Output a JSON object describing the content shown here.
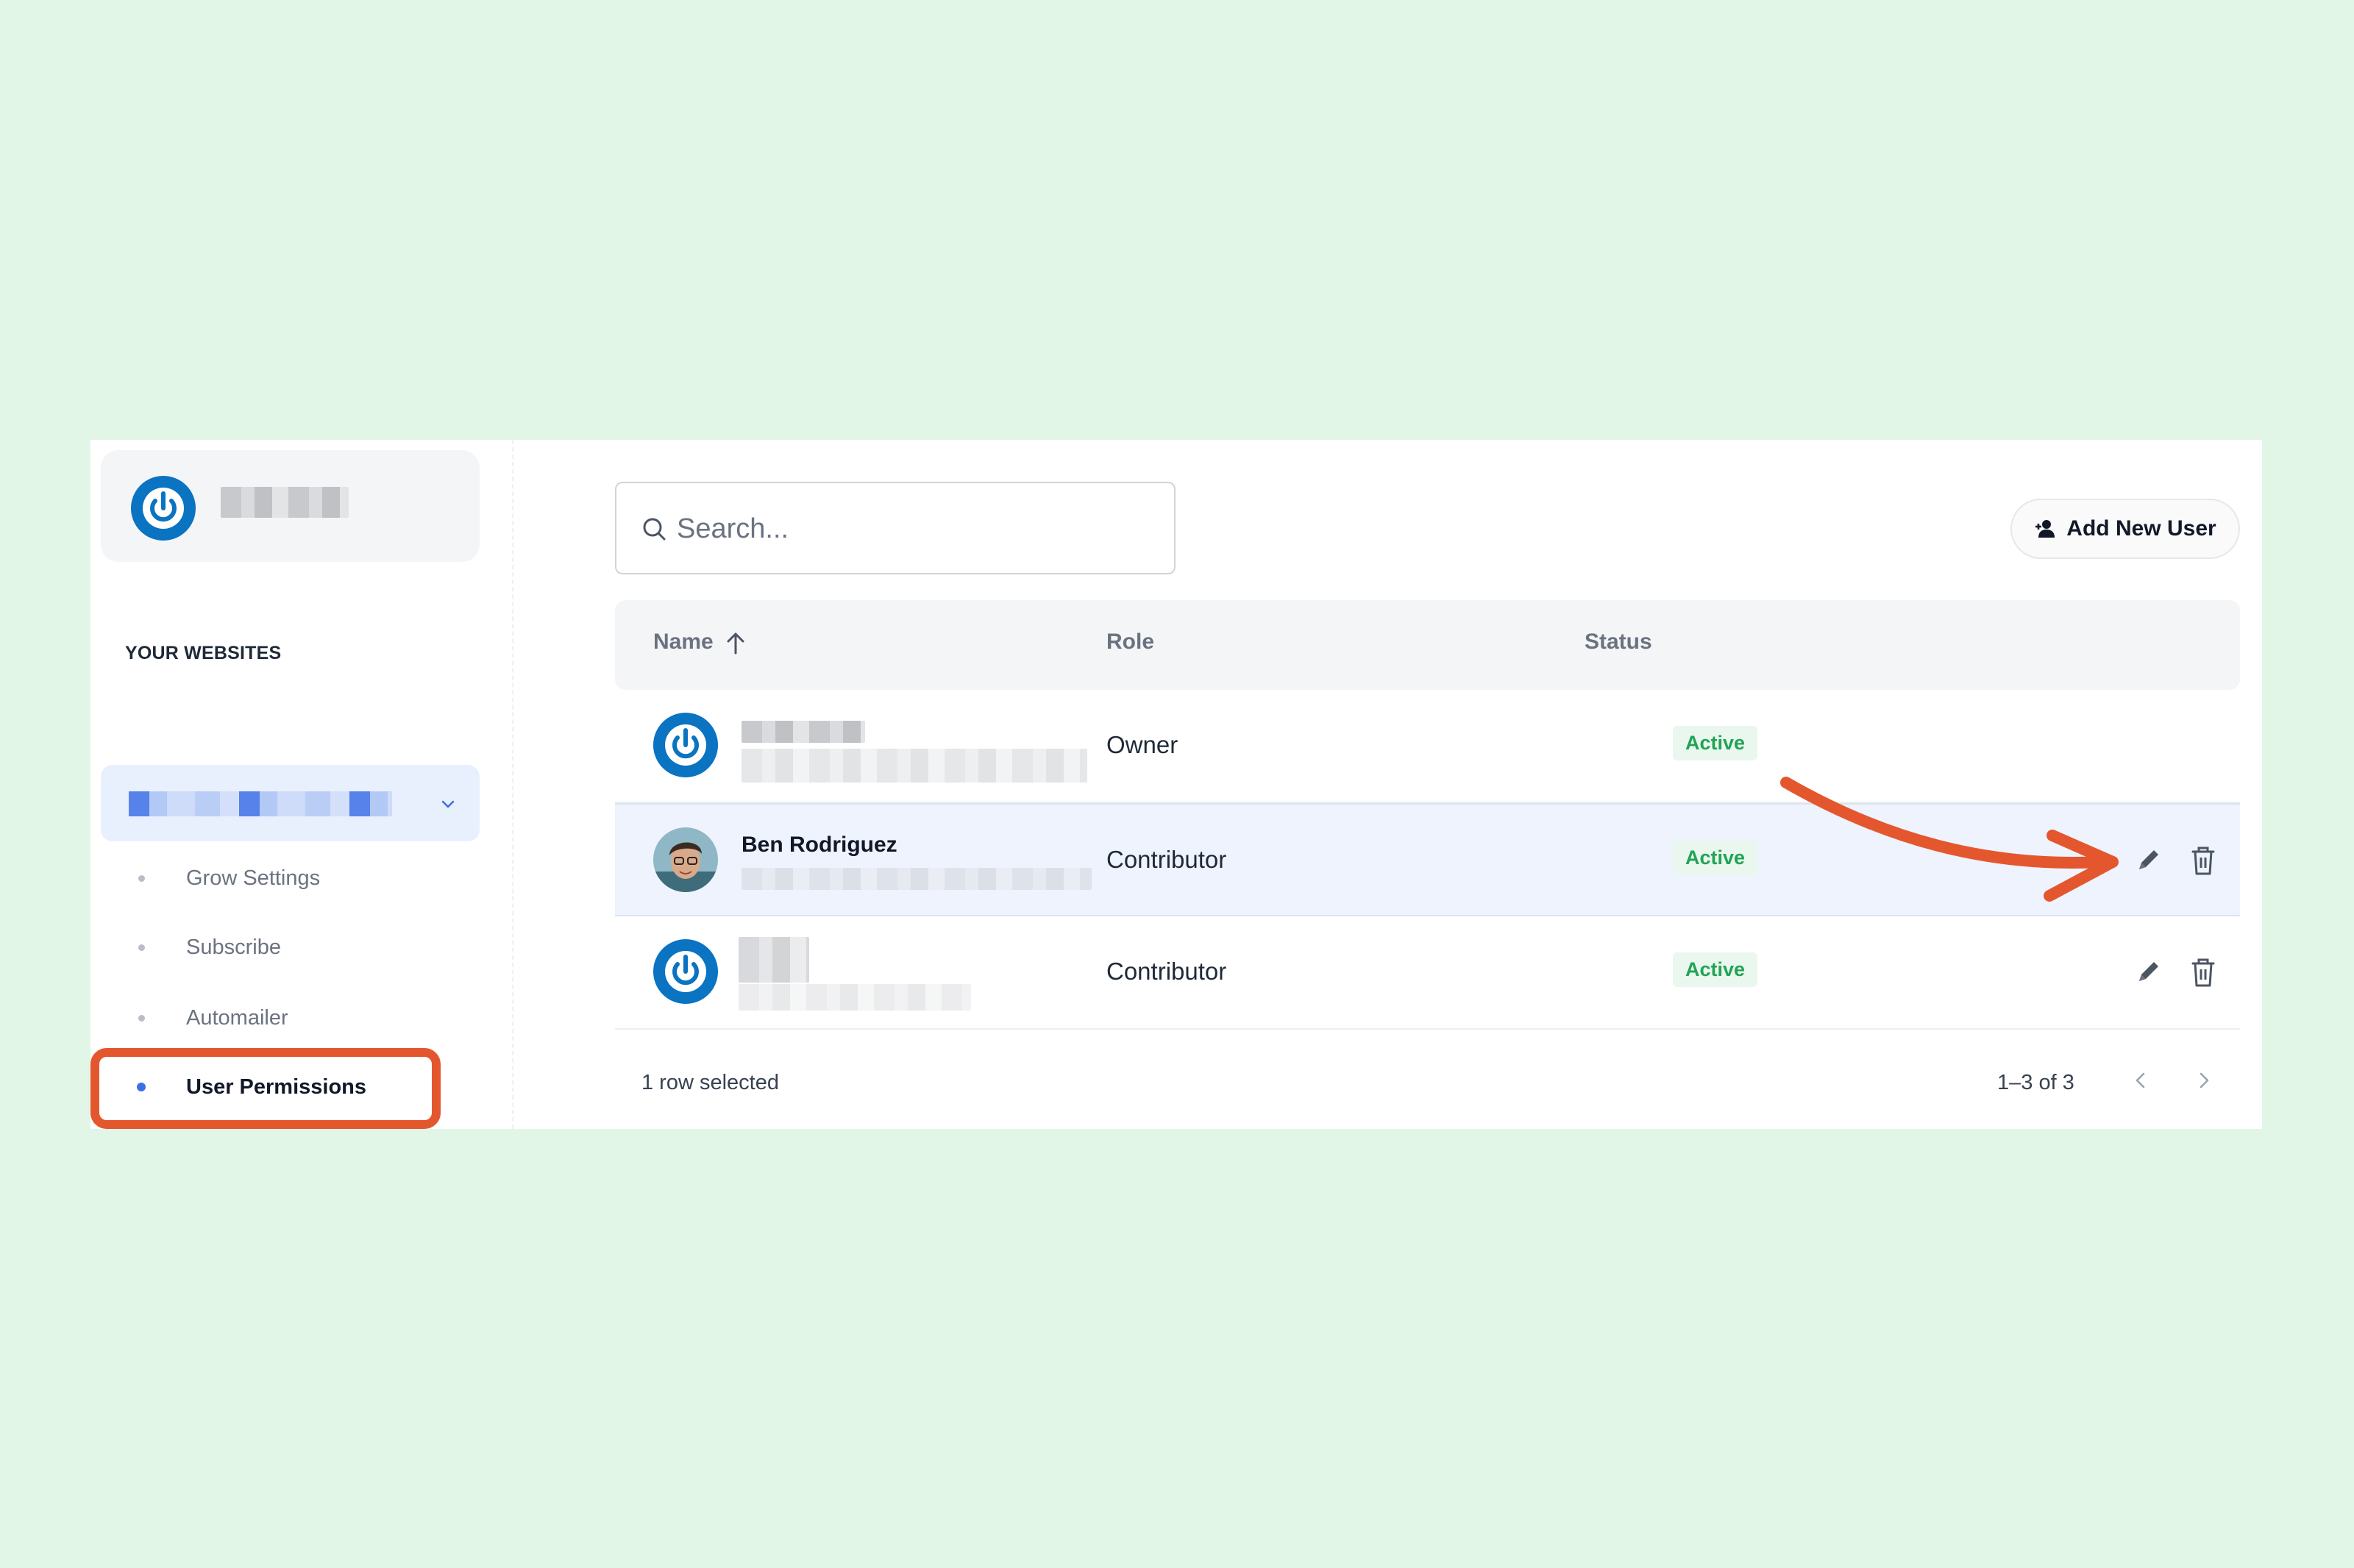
{
  "sidebar": {
    "section_heading": "YOUR WEBSITES",
    "nav_items": [
      {
        "label": "Grow Settings",
        "active": false
      },
      {
        "label": "Subscribe",
        "active": false
      },
      {
        "label": "Automailer",
        "active": false
      },
      {
        "label": "User Permissions",
        "active": true
      }
    ]
  },
  "toolbar": {
    "search_placeholder": "Search...",
    "add_user_label": "Add New User"
  },
  "table": {
    "columns": [
      {
        "label": "Name",
        "sorted": "ascending"
      },
      {
        "label": "Role"
      },
      {
        "label": "Status"
      }
    ],
    "rows": [
      {
        "name": "",
        "role": "Owner",
        "status": "Active",
        "selected": false,
        "avatar": "power-logo"
      },
      {
        "name": "Ben Rodriguez",
        "role": "Contributor",
        "status": "Active",
        "selected": true,
        "avatar": "photo"
      },
      {
        "name": "",
        "role": "Contributor",
        "status": "Active",
        "selected": false,
        "avatar": "power-logo"
      }
    ]
  },
  "footer": {
    "selection_text": "1 row selected",
    "pagination_text": "1–3 of 3"
  },
  "colors": {
    "accent_blue": "#0a73c2",
    "status_green": "#22a356",
    "highlight_orange": "#e4572e",
    "background": "#e1f6e6"
  },
  "icons": [
    "power-icon",
    "chevron-down-icon",
    "search-icon",
    "add-user-icon",
    "sort-arrow-up-icon",
    "edit-icon",
    "trash-icon",
    "chevron-left-icon",
    "chevron-right-icon"
  ]
}
